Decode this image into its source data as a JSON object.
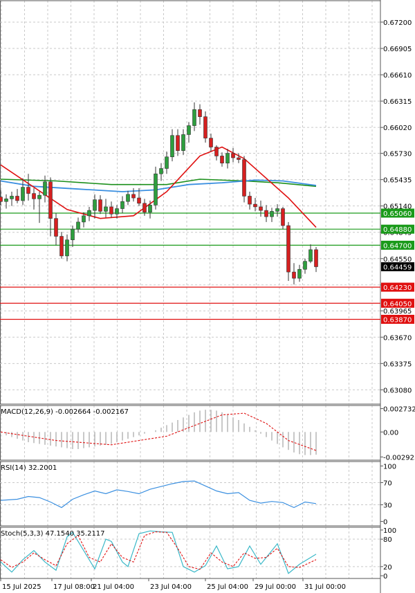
{
  "colors": {
    "bull": "#2e9e3e",
    "bear": "#d62020",
    "support_line": "#e01010",
    "resistance_line": "#1a9a1a",
    "ma_red": "#e01010",
    "ma_green": "#1a8f1a",
    "ma_blue": "#3a8fe0",
    "macd_hist": "#b0b0b0",
    "macd_signal": "#e01010",
    "rsi": "#3a8fe0",
    "stoch_main": "#3ab8c8",
    "stoch_signal": "#e01010",
    "grid": "#c9c9c9",
    "current_price_tag": "#000000"
  },
  "chart_data": [
    {
      "type": "candlestick",
      "panel": "price",
      "ylim": [
        0.6292,
        0.6744
      ],
      "y_ticks": [
        "0.67200",
        "0.66905",
        "0.66610",
        "0.66315",
        "0.66020",
        "0.65730",
        "0.65435",
        "0.65140",
        "0.64845",
        "0.64550",
        "0.64255",
        "0.63965",
        "0.63670",
        "0.63375",
        "0.63080"
      ],
      "y_tick_values": [
        0.672,
        0.66905,
        0.6661,
        0.66315,
        0.6602,
        0.6573,
        0.65435,
        0.6514,
        0.64845,
        0.6455,
        0.64255,
        0.63965,
        0.6367,
        0.63375,
        0.6308
      ],
      "x_ticks": [
        "15 Jul 2025",
        "17 Jul 08:00",
        "21 Jul 04:00",
        "23 Jul 04:00",
        "25 Jul 04:00",
        "29 Jul 00:00",
        "31 Jul 00:00"
      ],
      "x_tick_index": [
        1,
        21,
        39,
        56,
        73,
        90,
        107
      ],
      "price_labels": [
        {
          "value": 0.6506,
          "label": "0.65060",
          "color": "#1a9a1a"
        },
        {
          "value": 0.6488,
          "label": "0.64880",
          "color": "#1a9a1a"
        },
        {
          "value": 0.647,
          "label": "0.64700",
          "color": "#1a9a1a"
        },
        {
          "value": 0.64459,
          "label": "0.64459",
          "color": "#000000"
        },
        {
          "value": 0.6423,
          "label": "0.64230",
          "color": "#e01010"
        },
        {
          "value": 0.6405,
          "label": "0.64050",
          "color": "#e01010"
        },
        {
          "value": 0.6387,
          "label": "0.63870",
          "color": "#e01010"
        }
      ],
      "horizontal_lines": [
        {
          "value": 0.6506,
          "kind": "resistance"
        },
        {
          "value": 0.6488,
          "kind": "resistance"
        },
        {
          "value": 0.647,
          "kind": "resistance"
        },
        {
          "value": 0.6423,
          "kind": "support"
        },
        {
          "value": 0.6405,
          "kind": "support"
        },
        {
          "value": 0.6387,
          "kind": "support"
        }
      ],
      "candles": [
        [
          0.6524,
          0.6532,
          0.6515,
          0.6519
        ],
        [
          0.6519,
          0.6527,
          0.6511,
          0.6522
        ],
        [
          0.6522,
          0.653,
          0.6514,
          0.6525
        ],
        [
          0.6525,
          0.6533,
          0.6517,
          0.652
        ],
        [
          0.652,
          0.6545,
          0.6515,
          0.6535
        ],
        [
          0.6535,
          0.655,
          0.652,
          0.6528
        ],
        [
          0.6528,
          0.6534,
          0.651,
          0.6522
        ],
        [
          0.6522,
          0.653,
          0.6495,
          0.6526
        ],
        [
          0.6526,
          0.6548,
          0.6518,
          0.6541
        ],
        [
          0.6541,
          0.6546,
          0.648,
          0.65
        ],
        [
          0.65,
          0.6506,
          0.647,
          0.648
        ],
        [
          0.648,
          0.6485,
          0.6455,
          0.6458
        ],
        [
          0.6458,
          0.6482,
          0.6452,
          0.6476
        ],
        [
          0.6476,
          0.6492,
          0.6468,
          0.6488
        ],
        [
          0.6488,
          0.6501,
          0.6484,
          0.6496
        ],
        [
          0.6496,
          0.6507,
          0.649,
          0.6503
        ],
        [
          0.6503,
          0.6513,
          0.6497,
          0.6509
        ],
        [
          0.6509,
          0.6527,
          0.65,
          0.6521
        ],
        [
          0.6521,
          0.6526,
          0.6505,
          0.6508
        ],
        [
          0.6508,
          0.6522,
          0.6501,
          0.6513
        ],
        [
          0.6513,
          0.6519,
          0.6501,
          0.6505
        ],
        [
          0.6505,
          0.6515,
          0.65,
          0.6511
        ],
        [
          0.6511,
          0.6525,
          0.6506,
          0.6519
        ],
        [
          0.6519,
          0.6531,
          0.6515,
          0.6527
        ],
        [
          0.6527,
          0.6534,
          0.6519,
          0.6523
        ],
        [
          0.6523,
          0.6534,
          0.6514,
          0.6517
        ],
        [
          0.6517,
          0.6522,
          0.6503,
          0.6507
        ],
        [
          0.6507,
          0.652,
          0.65,
          0.6515
        ],
        [
          0.6515,
          0.6558,
          0.651,
          0.655
        ],
        [
          0.655,
          0.6562,
          0.6542,
          0.6556
        ],
        [
          0.6556,
          0.6575,
          0.655,
          0.6569
        ],
        [
          0.6569,
          0.66,
          0.6564,
          0.6593
        ],
        [
          0.6593,
          0.66,
          0.657,
          0.6576
        ],
        [
          0.6576,
          0.66,
          0.6571,
          0.6594
        ],
        [
          0.6594,
          0.6608,
          0.6585,
          0.6604
        ],
        [
          0.6604,
          0.663,
          0.6598,
          0.6622
        ],
        [
          0.6622,
          0.6628,
          0.6605,
          0.6614
        ],
        [
          0.6614,
          0.662,
          0.6585,
          0.659
        ],
        [
          0.659,
          0.6595,
          0.6575,
          0.658
        ],
        [
          0.658,
          0.6582,
          0.6565,
          0.657
        ],
        [
          0.657,
          0.6574,
          0.6558,
          0.6562
        ],
        [
          0.6562,
          0.6578,
          0.6556,
          0.6573
        ],
        [
          0.6573,
          0.6579,
          0.6563,
          0.6568
        ],
        [
          0.6568,
          0.6573,
          0.6562,
          0.6566
        ],
        [
          0.6566,
          0.657,
          0.6518,
          0.6525
        ],
        [
          0.6525,
          0.653,
          0.651,
          0.6516
        ],
        [
          0.6516,
          0.6523,
          0.6508,
          0.6513
        ],
        [
          0.6513,
          0.652,
          0.6502,
          0.6509
        ],
        [
          0.6509,
          0.6515,
          0.6496,
          0.6502
        ],
        [
          0.6502,
          0.6512,
          0.6496,
          0.6508
        ],
        [
          0.6508,
          0.6516,
          0.6502,
          0.6511
        ],
        [
          0.6511,
          0.6513,
          0.6488,
          0.6492
        ],
        [
          0.6492,
          0.6496,
          0.643,
          0.644
        ],
        [
          0.644,
          0.645,
          0.6426,
          0.6433
        ],
        [
          0.6433,
          0.6448,
          0.6429,
          0.6443
        ],
        [
          0.6443,
          0.6455,
          0.6438,
          0.6452
        ],
        [
          0.6452,
          0.6471,
          0.645,
          0.6465
        ],
        [
          0.6465,
          0.6468,
          0.644,
          0.64459
        ]
      ],
      "ma_red": [
        [
          0,
          0.656
        ],
        [
          6,
          0.6535
        ],
        [
          12,
          0.651
        ],
        [
          18,
          0.65
        ],
        [
          24,
          0.6503
        ],
        [
          30,
          0.653
        ],
        [
          36,
          0.657
        ],
        [
          40,
          0.658
        ],
        [
          44,
          0.6567
        ],
        [
          48,
          0.6545
        ],
        [
          52,
          0.6523
        ],
        [
          57,
          0.649
        ]
      ],
      "ma_green": [
        [
          0,
          0.6544
        ],
        [
          10,
          0.6542
        ],
        [
          20,
          0.6538
        ],
        [
          30,
          0.6538
        ],
        [
          36,
          0.6544
        ],
        [
          44,
          0.6542
        ],
        [
          50,
          0.654
        ],
        [
          57,
          0.6536
        ]
      ],
      "ma_blue": [
        [
          0,
          0.6542
        ],
        [
          6,
          0.6536
        ],
        [
          14,
          0.6533
        ],
        [
          22,
          0.653
        ],
        [
          28,
          0.6532
        ],
        [
          34,
          0.6538
        ],
        [
          40,
          0.654
        ],
        [
          46,
          0.6543
        ],
        [
          51,
          0.6542
        ],
        [
          57,
          0.6537
        ]
      ]
    },
    {
      "type": "bar",
      "panel": "macd",
      "label": "MACD(12,26,9) -0.002664 -0.002167",
      "ylim": [
        -0.0033,
        0.0031
      ],
      "y_ticks": [
        "0.002732",
        "0.00",
        "-0.002925"
      ],
      "y_tick_values": [
        0.002732,
        0.0,
        -0.002925
      ],
      "histogram": [
        -0.0002,
        -0.0004,
        -0.0006,
        -0.0008,
        -0.001,
        -0.0012,
        -0.0013,
        -0.0014,
        -0.0015,
        -0.0016,
        -0.0017,
        -0.0018,
        -0.0019,
        -0.002,
        -0.002,
        -0.0019,
        -0.0018,
        -0.0017,
        -0.0016,
        -0.0015,
        -0.0014,
        -0.0012,
        -0.001,
        -0.0008,
        -0.0006,
        -0.0004,
        -0.0002,
        0.0,
        0.0002,
        0.0005,
        0.0008,
        0.0011,
        0.0014,
        0.0017,
        0.002,
        0.0023,
        0.0025,
        0.0026,
        0.0026,
        0.0025,
        0.0023,
        0.002,
        0.0017,
        0.0014,
        0.001,
        0.0006,
        0.0002,
        -0.0002,
        -0.0006,
        -0.001,
        -0.0014,
        -0.0018,
        -0.0021,
        -0.0024,
        -0.0026,
        -0.0027,
        -0.0027,
        -0.002664
      ],
      "signal": [
        [
          0,
          0.0
        ],
        [
          10,
          -0.001
        ],
        [
          20,
          -0.0015
        ],
        [
          30,
          -0.0005
        ],
        [
          36,
          0.001
        ],
        [
          40,
          0.002
        ],
        [
          44,
          0.0022
        ],
        [
          48,
          0.001
        ],
        [
          52,
          -0.001
        ],
        [
          57,
          -0.002167
        ]
      ]
    },
    {
      "type": "line",
      "panel": "rsi",
      "label": "RSI(14) 32.2001",
      "ylim": [
        0,
        100
      ],
      "y_ticks": [
        "100",
        "70",
        "30",
        "0"
      ],
      "y_tick_values": [
        100,
        70,
        30,
        0
      ],
      "values": [
        [
          0,
          38
        ],
        [
          3,
          40
        ],
        [
          5,
          45
        ],
        [
          7,
          43
        ],
        [
          9,
          35
        ],
        [
          11,
          25
        ],
        [
          13,
          40
        ],
        [
          15,
          48
        ],
        [
          17,
          55
        ],
        [
          19,
          50
        ],
        [
          21,
          57
        ],
        [
          23,
          54
        ],
        [
          25,
          50
        ],
        [
          27,
          58
        ],
        [
          29,
          63
        ],
        [
          31,
          68
        ],
        [
          33,
          72
        ],
        [
          35,
          73
        ],
        [
          37,
          64
        ],
        [
          39,
          55
        ],
        [
          41,
          50
        ],
        [
          43,
          52
        ],
        [
          45,
          38
        ],
        [
          47,
          33
        ],
        [
          49,
          36
        ],
        [
          51,
          34
        ],
        [
          53,
          25
        ],
        [
          55,
          35
        ],
        [
          57,
          32.2001
        ]
      ]
    },
    {
      "type": "line",
      "panel": "stoch",
      "label": "Stoch(5,3,3) 47.1540 35.2117",
      "ylim": [
        0,
        100
      ],
      "y_ticks": [
        "100",
        "80",
        "20",
        "0"
      ],
      "y_tick_values": [
        100,
        80,
        20,
        0
      ],
      "main": [
        [
          0,
          30
        ],
        [
          2,
          8
        ],
        [
          4,
          35
        ],
        [
          6,
          55
        ],
        [
          8,
          30
        ],
        [
          10,
          12
        ],
        [
          12,
          85
        ],
        [
          13,
          95
        ],
        [
          15,
          55
        ],
        [
          17,
          15
        ],
        [
          19,
          80
        ],
        [
          20,
          75
        ],
        [
          22,
          30
        ],
        [
          23,
          20
        ],
        [
          25,
          92
        ],
        [
          27,
          98
        ],
        [
          29,
          96
        ],
        [
          31,
          95
        ],
        [
          33,
          20
        ],
        [
          35,
          8
        ],
        [
          37,
          22
        ],
        [
          39,
          65
        ],
        [
          41,
          15
        ],
        [
          43,
          20
        ],
        [
          45,
          65
        ],
        [
          47,
          25
        ],
        [
          49,
          55
        ],
        [
          50,
          70
        ],
        [
          52,
          5
        ],
        [
          54,
          25
        ],
        [
          57,
          47.154
        ]
      ],
      "signal": [
        [
          0,
          35
        ],
        [
          2,
          18
        ],
        [
          4,
          30
        ],
        [
          6,
          50
        ],
        [
          8,
          35
        ],
        [
          10,
          22
        ],
        [
          12,
          70
        ],
        [
          14,
          88
        ],
        [
          16,
          40
        ],
        [
          18,
          30
        ],
        [
          20,
          70
        ],
        [
          22,
          40
        ],
        [
          24,
          30
        ],
        [
          26,
          88
        ],
        [
          28,
          96
        ],
        [
          30,
          95
        ],
        [
          32,
          60
        ],
        [
          34,
          20
        ],
        [
          36,
          14
        ],
        [
          38,
          50
        ],
        [
          40,
          30
        ],
        [
          42,
          20
        ],
        [
          44,
          50
        ],
        [
          46,
          38
        ],
        [
          48,
          40
        ],
        [
          50,
          60
        ],
        [
          52,
          20
        ],
        [
          54,
          18
        ],
        [
          57,
          35.2117
        ]
      ]
    }
  ]
}
